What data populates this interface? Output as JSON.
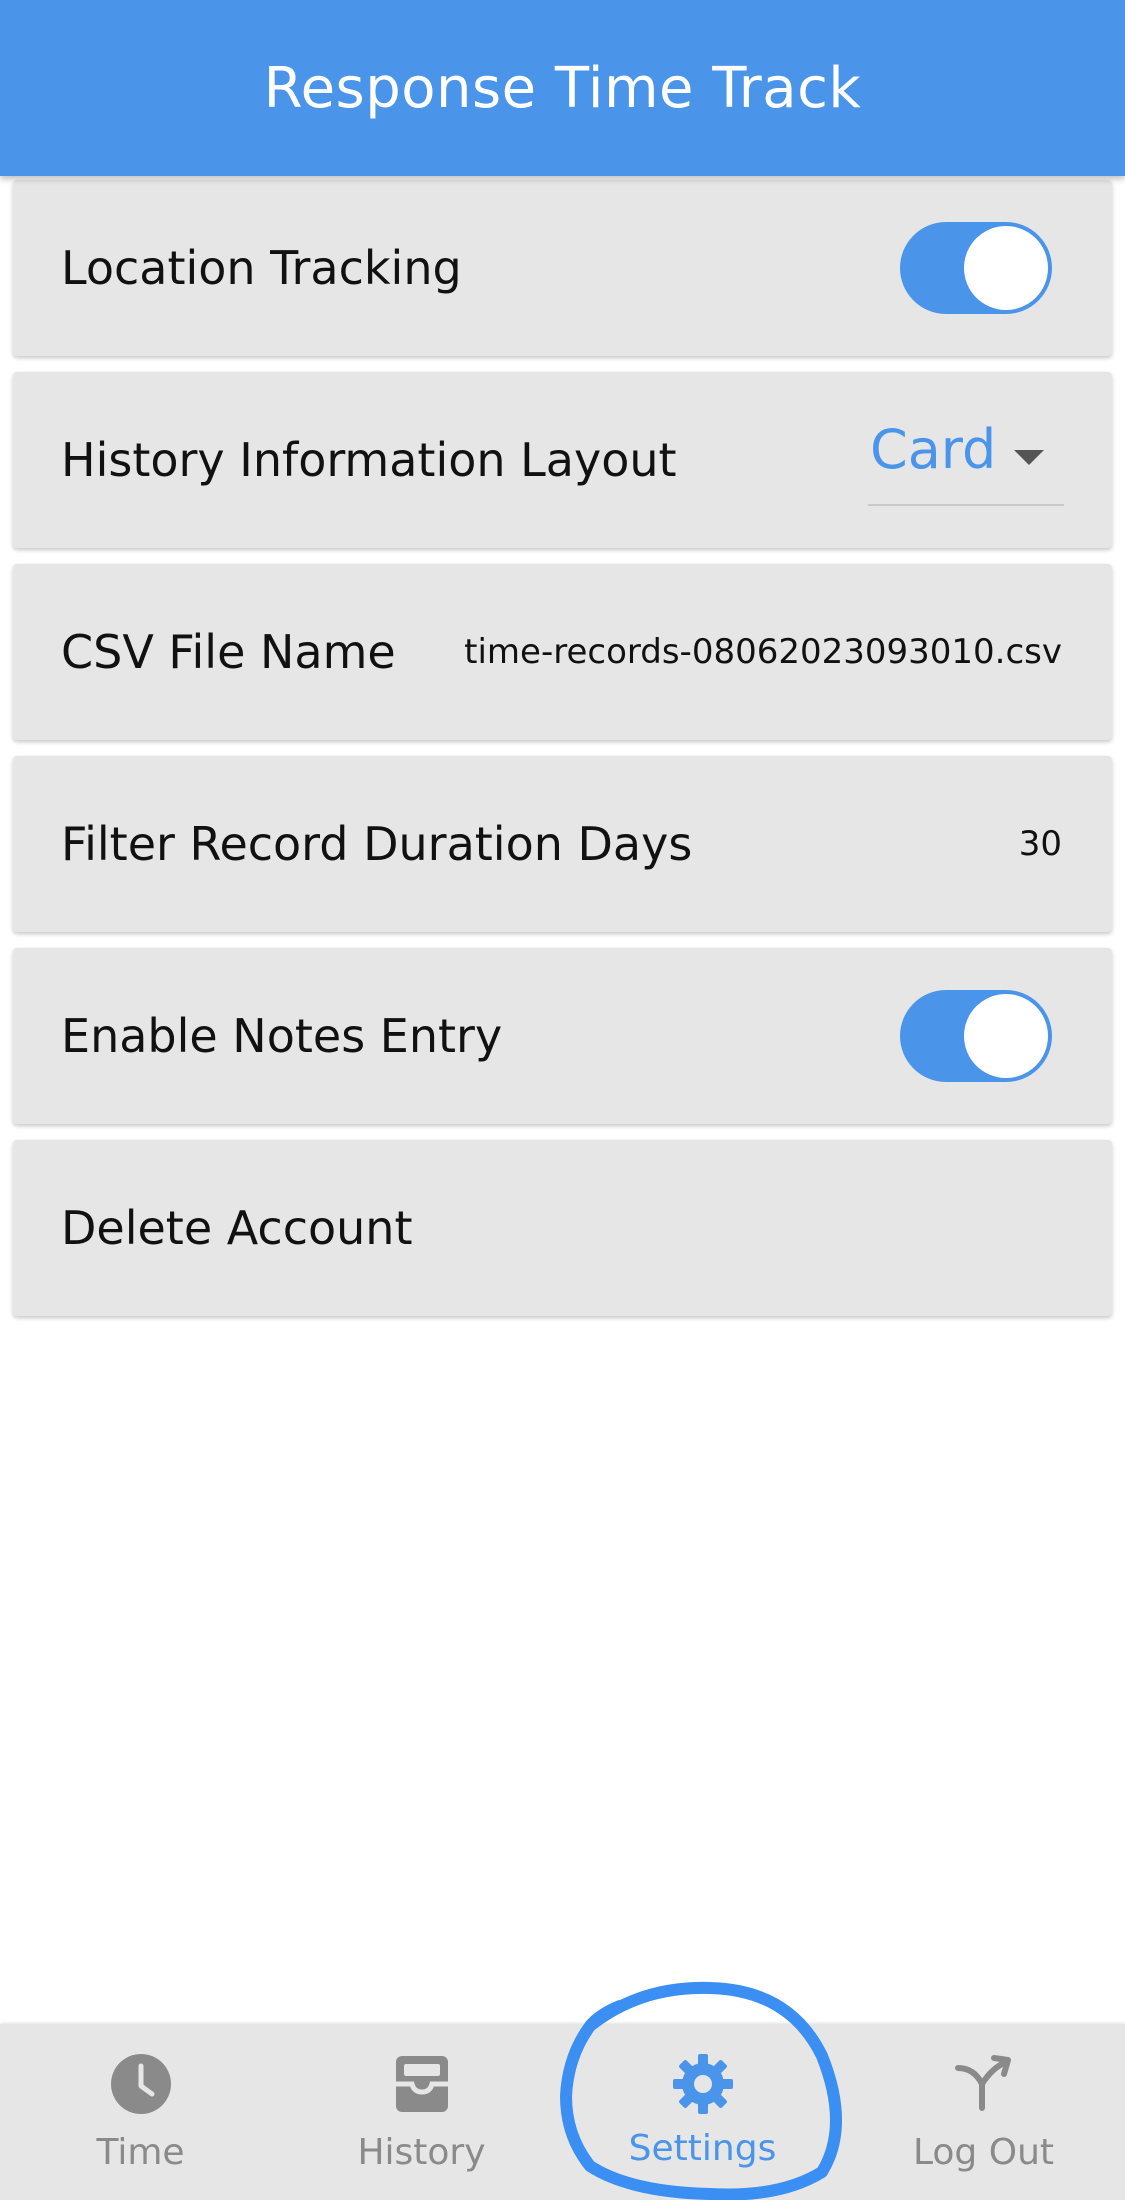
{
  "app": {
    "title": "Response Time Track"
  },
  "settings": {
    "location_tracking": {
      "label": "Location Tracking",
      "enabled": true
    },
    "history_layout": {
      "label": "History Information Layout",
      "selected": "Card"
    },
    "csv_file": {
      "label": "CSV File Name",
      "value": "time-records-08062023093010.csv"
    },
    "filter_days": {
      "label": "Filter Record Duration Days",
      "value": "30"
    },
    "notes_entry": {
      "label": "Enable Notes Entry",
      "enabled": true
    },
    "delete_account": {
      "label": "Delete Account"
    }
  },
  "nav": {
    "time": {
      "label": "Time",
      "icon": "clock-icon"
    },
    "history": {
      "label": "History",
      "icon": "inbox-icon"
    },
    "settings": {
      "label": "Settings",
      "icon": "gear-icon",
      "active": true
    },
    "logout": {
      "label": "Log Out",
      "icon": "merge-arrow-icon"
    }
  },
  "colors": {
    "accent": "#4a94ea",
    "card": "#e6e6e6",
    "inactive": "#8a8a8a",
    "annotation": "#3b8ef2"
  }
}
